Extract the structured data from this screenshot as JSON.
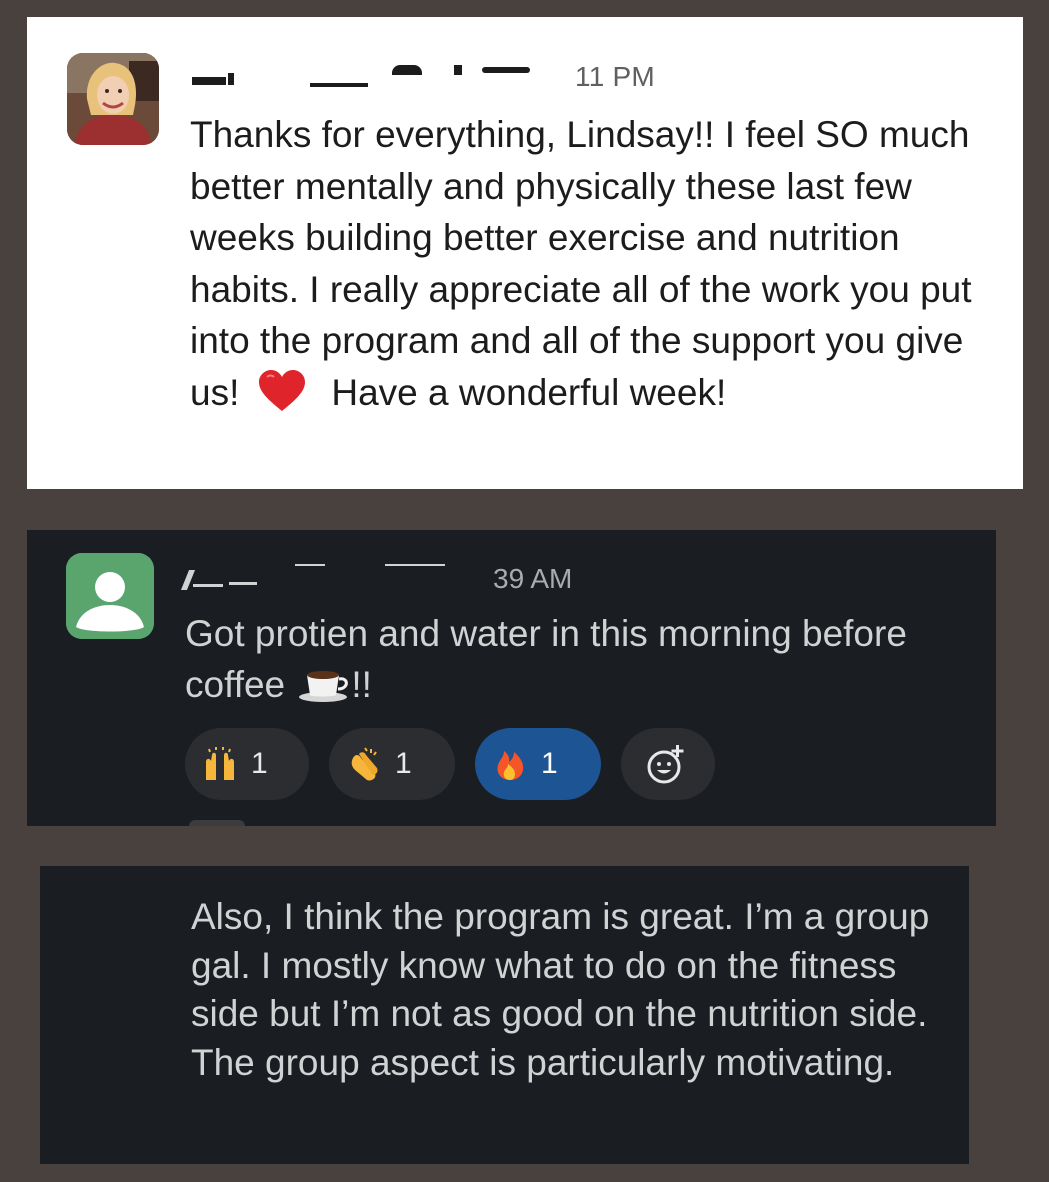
{
  "message1": {
    "timestamp_visible": "11 PM",
    "text_before_heart": "Thanks for everything, Lindsay!! I feel SO much better mentally and physically these last few weeks building better exercise and nutrition habits. I really appreciate all of the work you put into the program and all of the support you give us!",
    "heart_icon": "red-heart-icon",
    "text_after_heart": "Have a wonderful week!"
  },
  "message2": {
    "timestamp_visible": "39 AM",
    "text": "Got protien and water in this morning before coffee",
    "coffee_icon": "coffee-cup-icon",
    "text_suffix": "!!",
    "reactions": [
      {
        "icon": "raised-hands-icon",
        "count": "1",
        "active": false
      },
      {
        "icon": "clapping-hands-icon",
        "count": "1",
        "active": false
      },
      {
        "icon": "fire-icon",
        "count": "1",
        "active": true
      }
    ],
    "add_reaction_icon": "add-reaction-icon"
  },
  "message3": {
    "text": "Also, I think the program is great. I’m a group gal. I mostly know what to do on the fitness side but I’m not as good on the nutrition side. The group aspect is particularly motivating."
  },
  "colors": {
    "page_background": "#48413e",
    "light_card": "#ffffff",
    "dark_card": "#1a1d21",
    "active_reaction": "#1d5494",
    "inactive_reaction": "#2c2d30",
    "avatar_green": "#5aa46e"
  }
}
